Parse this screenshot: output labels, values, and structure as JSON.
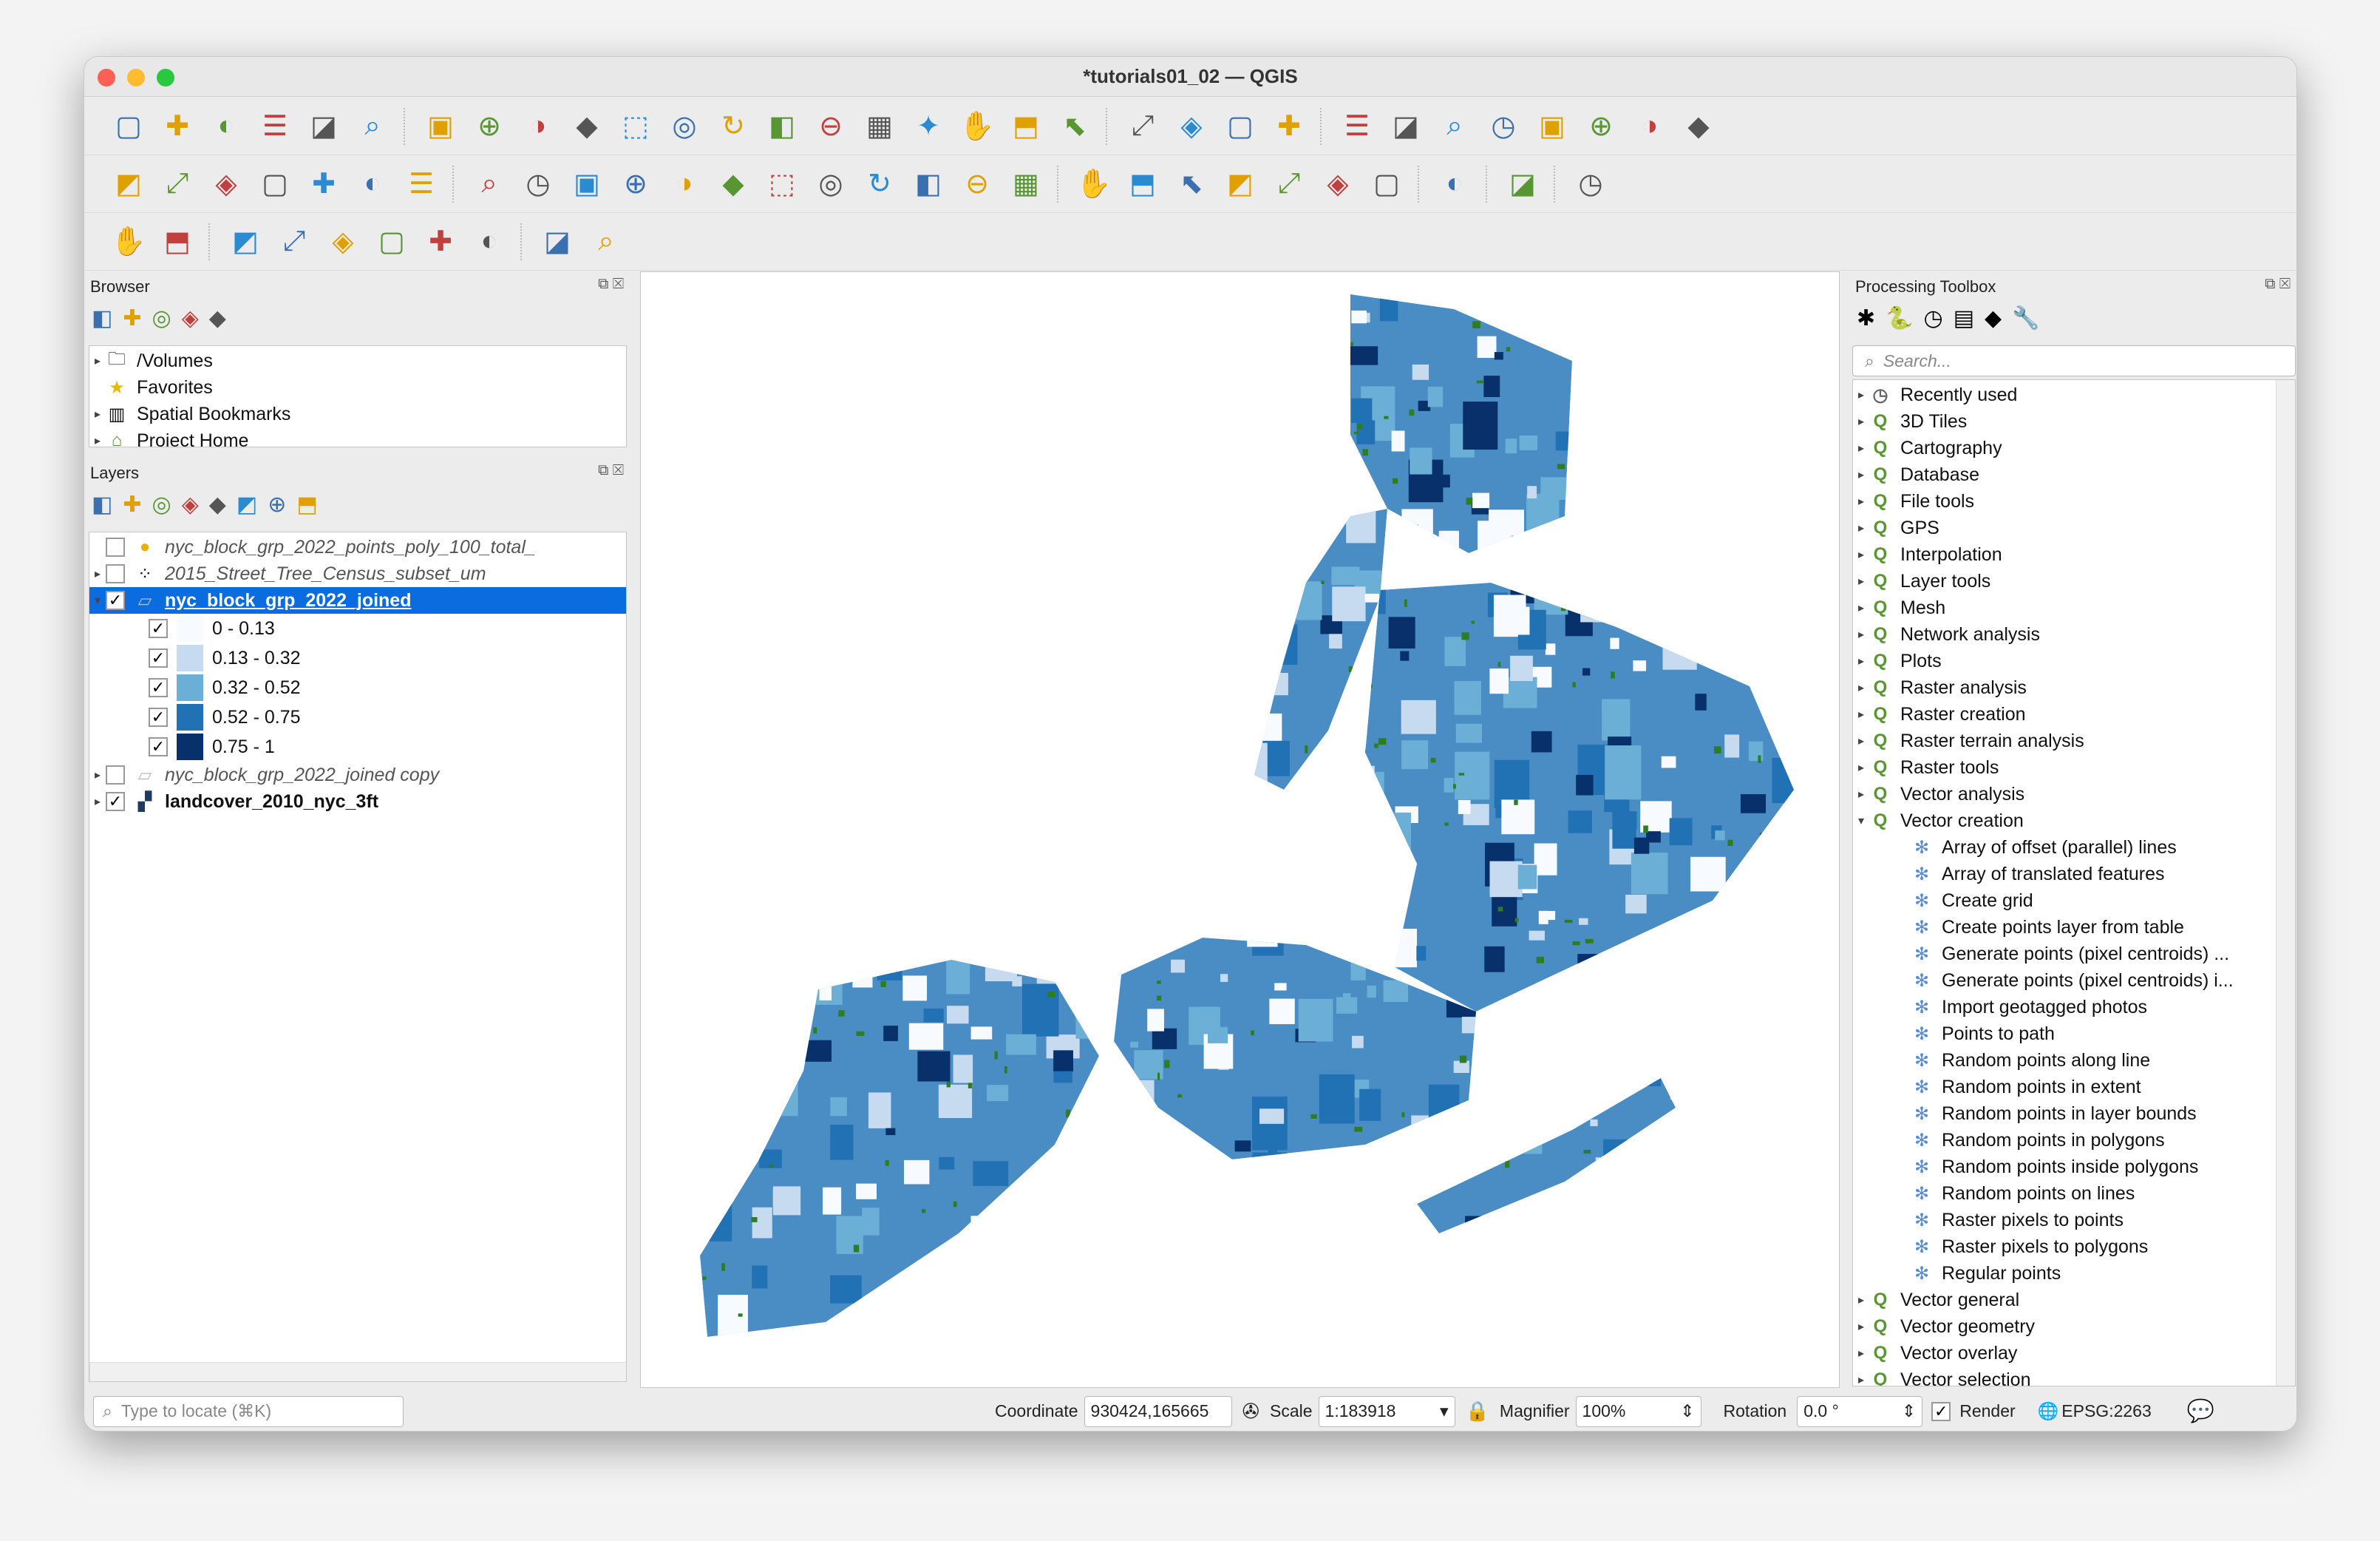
{
  "window": {
    "title": "*tutorials01_02 — QGIS"
  },
  "toolbar_rows": [
    [
      "new-project",
      "open-project",
      "save-project",
      "save-as",
      "print-layout",
      "style-manager",
      "|",
      "pan",
      "pan-to-selection",
      "zoom-in",
      "zoom-out",
      "zoom-full",
      "zoom-to-selection",
      "zoom-to-layer",
      "zoom-native",
      "zoom-last",
      "zoom-next",
      "new-map-view",
      "new-3d-view",
      "temporal-controller",
      "refresh",
      "|",
      "select-features",
      "select-by-value",
      "deselect",
      "select-by-location",
      "|",
      "identify",
      "attribute-table",
      "processing-toolbox",
      "statistics",
      "open-field-calculator",
      "measure",
      "annotation",
      "locator-settings"
    ],
    [
      "add-vector-layer",
      "add-raster-layer",
      "add-delimited-text",
      "digitize",
      "add-wms",
      "add-wcs",
      "add-wfs",
      "|",
      "current-edits",
      "toggle-editing",
      "save-edits",
      "add-feature",
      "move-feature",
      "vertex-tool",
      "delete-selected",
      "cut-features",
      "copy-features",
      "paste-features",
      "undo",
      "redo",
      "|",
      "label-tool",
      "diagram",
      "pin-labels",
      "show-hide-labels",
      "move-label",
      "rotate-label",
      "change-label",
      "|",
      "globe",
      "|",
      "python-console",
      "|",
      "help"
    ],
    [
      "locator",
      "plugin-icon",
      "|",
      "georeferencer",
      "add-point",
      "offset",
      "measure-angle",
      "grass",
      "select-tool",
      "|",
      "info",
      "settings-tool"
    ]
  ],
  "browser": {
    "title": "Browser",
    "toolbar": [
      "add-selected",
      "refresh",
      "filter",
      "collapse",
      "properties"
    ],
    "items": [
      {
        "label": "/Volumes",
        "icon": "folder-icon"
      },
      {
        "label": "Favorites",
        "icon": "star-icon"
      },
      {
        "label": "Spatial Bookmarks",
        "icon": "bookmark-icon"
      },
      {
        "label": "Project Home",
        "icon": "project-home-icon"
      }
    ]
  },
  "layers": {
    "title": "Layers",
    "toolbar": [
      "style",
      "add-group",
      "visibility",
      "filter",
      "expression",
      "expand",
      "collapse",
      "remove"
    ],
    "items": [
      {
        "label": "nyc_block_grp_2022_points_poly_100_total_",
        "checked": false,
        "style": "ital",
        "icon": "point-layer-icon"
      },
      {
        "label": "2015_Street_Tree_Census_subset_um",
        "checked": false,
        "style": "ital",
        "icon": "point-cluster-icon"
      },
      {
        "label": "nyc_block_grp_2022_joined",
        "checked": true,
        "style": "sel",
        "icon": "polygon-layer-icon"
      },
      {
        "label": "nyc_block_grp_2022_joined copy",
        "checked": false,
        "style": "ital",
        "icon": "polygon-layer-icon"
      },
      {
        "label": "landcover_2010_nyc_3ft",
        "checked": true,
        "style": "bold",
        "icon": "raster-layer-icon"
      }
    ],
    "legend": [
      {
        "label": "0 - 0.13",
        "color": "#f7fbff"
      },
      {
        "label": "0.13 - 0.32",
        "color": "#c6dbef"
      },
      {
        "label": "0.32 - 0.52",
        "color": "#6baed6"
      },
      {
        "label": "0.52 - 0.75",
        "color": "#2171b5"
      },
      {
        "label": "0.75 - 1",
        "color": "#08306b"
      }
    ]
  },
  "toolbox": {
    "title": "Processing Toolbox",
    "search_placeholder": "Search...",
    "items": [
      {
        "label": "Recently used",
        "type": "group",
        "icon": "clock-icon"
      },
      {
        "label": "3D Tiles",
        "type": "group"
      },
      {
        "label": "Cartography",
        "type": "group"
      },
      {
        "label": "Database",
        "type": "group"
      },
      {
        "label": "File tools",
        "type": "group"
      },
      {
        "label": "GPS",
        "type": "group"
      },
      {
        "label": "Interpolation",
        "type": "group"
      },
      {
        "label": "Layer tools",
        "type": "group"
      },
      {
        "label": "Mesh",
        "type": "group"
      },
      {
        "label": "Network analysis",
        "type": "group"
      },
      {
        "label": "Plots",
        "type": "group"
      },
      {
        "label": "Raster analysis",
        "type": "group"
      },
      {
        "label": "Raster creation",
        "type": "group"
      },
      {
        "label": "Raster terrain analysis",
        "type": "group"
      },
      {
        "label": "Raster tools",
        "type": "group"
      },
      {
        "label": "Vector analysis",
        "type": "group"
      },
      {
        "label": "Vector creation",
        "type": "open"
      },
      {
        "label": "Array of offset (parallel) lines",
        "type": "alg"
      },
      {
        "label": "Array of translated features",
        "type": "alg"
      },
      {
        "label": "Create grid",
        "type": "alg"
      },
      {
        "label": "Create points layer from table",
        "type": "alg"
      },
      {
        "label": "Generate points (pixel centroids) ...",
        "type": "alg"
      },
      {
        "label": "Generate points (pixel centroids) i...",
        "type": "alg"
      },
      {
        "label": "Import geotagged photos",
        "type": "alg"
      },
      {
        "label": "Points to path",
        "type": "alg"
      },
      {
        "label": "Random points along line",
        "type": "alg"
      },
      {
        "label": "Random points in extent",
        "type": "alg"
      },
      {
        "label": "Random points in layer bounds",
        "type": "alg"
      },
      {
        "label": "Random points in polygons",
        "type": "alg"
      },
      {
        "label": "Random points inside polygons",
        "type": "alg"
      },
      {
        "label": "Random points on lines",
        "type": "alg"
      },
      {
        "label": "Raster pixels to points",
        "type": "alg"
      },
      {
        "label": "Raster pixels to polygons",
        "type": "alg"
      },
      {
        "label": "Regular points",
        "type": "alg"
      },
      {
        "label": "Vector general",
        "type": "group"
      },
      {
        "label": "Vector geometry",
        "type": "group"
      },
      {
        "label": "Vector overlay",
        "type": "group"
      },
      {
        "label": "Vector selection",
        "type": "group"
      }
    ]
  },
  "status": {
    "locate_placeholder": "Type to locate (⌘K)",
    "coordinate_label": "Coordinate",
    "coordinate": "930424,165665",
    "scale_label": "Scale",
    "scale": "1:183918",
    "magnifier_label": "Magnifier",
    "magnifier": "100%",
    "rotation_label": "Rotation",
    "rotation": "0.0 °",
    "render_label": "Render",
    "render_checked": true,
    "crs": "EPSG:2263"
  },
  "colors": {
    "selection": "#0a6cde",
    "qgis_green": "#589632",
    "landcover_green": "#2e7d1e"
  }
}
